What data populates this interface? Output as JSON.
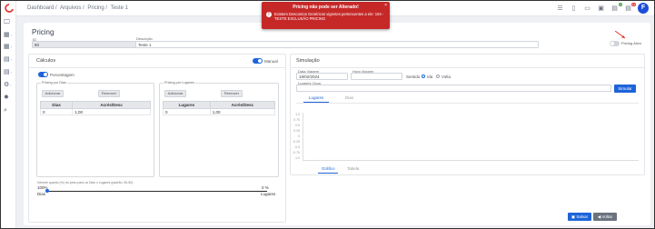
{
  "breadcrumb": [
    "Dashboard /",
    "Arquivos /",
    "Pricing /",
    "Teste 1"
  ],
  "alert": {
    "title": "Pricing não pode ser Alterado!",
    "message": "Existem Descontos Genéricos vigentes pertencentes a ele: 194 - TESTE EXCLUSÃO PRICING",
    "close": "×"
  },
  "user": {
    "initial": "F"
  },
  "notifications": {
    "badge_a": "0",
    "badge_b": "14"
  },
  "page": {
    "title": "Pricing"
  },
  "form": {
    "id_label": "ID",
    "id_value": "80",
    "desc_label": "Descrição",
    "desc_value": "Teste 1",
    "active_label": "Pricing Ativo"
  },
  "calculos": {
    "title": "Cálculos",
    "manual_label": "Manual",
    "porcentagem_label": "Porcentagem",
    "dias_group": "Pricing por Dias",
    "lugares_group": "Pricing por Lugares",
    "add_label": "Adicionar",
    "remove_label": "Remover",
    "dias_table": {
      "headers": [
        "Dias",
        "Acrés/Desc"
      ],
      "rows": [
        [
          "0",
          "1,00"
        ]
      ]
    },
    "lugares_table": {
      "headers": [
        "Lugares",
        "Acrés/Desc"
      ],
      "rows": [
        [
          "0",
          "1,00"
        ]
      ]
    },
    "weight_note": "Informe quanto (%) do peso para os Dias x Lugares (padrão: 50-50)",
    "pct_left": "100%",
    "pct_right": "0 %",
    "dias_label": "Dias",
    "lugares_label": "Lugares",
    "slider_value_pct": 0
  },
  "simulacao": {
    "title": "Simulação",
    "date_label": "Data Viagem",
    "date_value": "19/02/2024",
    "hour_label": "Hora Viagem",
    "hour_value": "",
    "sentido_label": "Sentido",
    "ida_label": "Ida",
    "volta_label": "Volta",
    "lugares_label": "Lugares Ocup.",
    "simulate_label": "Simular",
    "tabs": [
      "Lugares",
      "Dias"
    ],
    "y_ticks": [
      "1.0",
      "0.75",
      "0.5",
      "0.25",
      "0",
      "-0.25",
      "-0.5",
      "-0.75",
      "-1.0"
    ],
    "bottom_tabs": [
      "Gráfico",
      "Tabela"
    ]
  },
  "footer": {
    "save_label": "Salvar",
    "back_label": "Voltar"
  }
}
